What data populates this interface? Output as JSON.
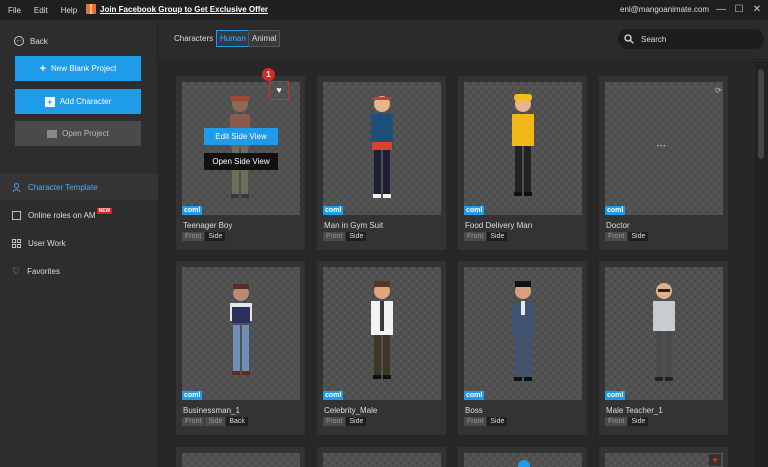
{
  "menu": {
    "file": "File",
    "edit": "Edit",
    "help": "Help"
  },
  "promo": "Join Facebook Group to Get Exclusive Offer",
  "account_email": "enl@mangoanimate.com",
  "window": {
    "minimize": "—",
    "maximize": "☐",
    "close": "✕"
  },
  "sidebar": {
    "back": "Back",
    "new_blank_project": "New Blank Project",
    "add_character": "Add Character",
    "open_project": "Open Project",
    "nav": [
      {
        "label": "Character Template"
      },
      {
        "label": "Online roles on AM",
        "badge": "NEW"
      },
      {
        "label": "User Work"
      },
      {
        "label": "Favorites"
      }
    ]
  },
  "topbar": {
    "characters_label": "Characters",
    "tabs": [
      "Human",
      "Animal"
    ],
    "search_placeholder": "Search"
  },
  "hover": {
    "edit_side_view": "Edit Side View",
    "open_side_view": "Open Side View",
    "callout": "1"
  },
  "badge_coml": "coml",
  "cards": [
    {
      "name": "Teenager Boy",
      "tags": [
        "Front",
        "Side"
      ]
    },
    {
      "name": "Man in Gym Suit",
      "tags": [
        "Front",
        "Side"
      ]
    },
    {
      "name": "Food Delivery Man",
      "tags": [
        "Front",
        "Side"
      ]
    },
    {
      "name": "Doctor",
      "tags": [
        "Front",
        "Side"
      ]
    },
    {
      "name": "Businessman_1",
      "tags": [
        "Front",
        "Side",
        "Back"
      ]
    },
    {
      "name": "Celebrity_Male",
      "tags": [
        "Front",
        "Side"
      ]
    },
    {
      "name": "Boss",
      "tags": [
        "Front",
        "Side"
      ]
    },
    {
      "name": "Male Teacher_1",
      "tags": [
        "Front",
        "Side"
      ]
    }
  ],
  "colors": {
    "accent": "#1e9be9",
    "favorite": "#e02828",
    "new_badge": "#e02020"
  }
}
